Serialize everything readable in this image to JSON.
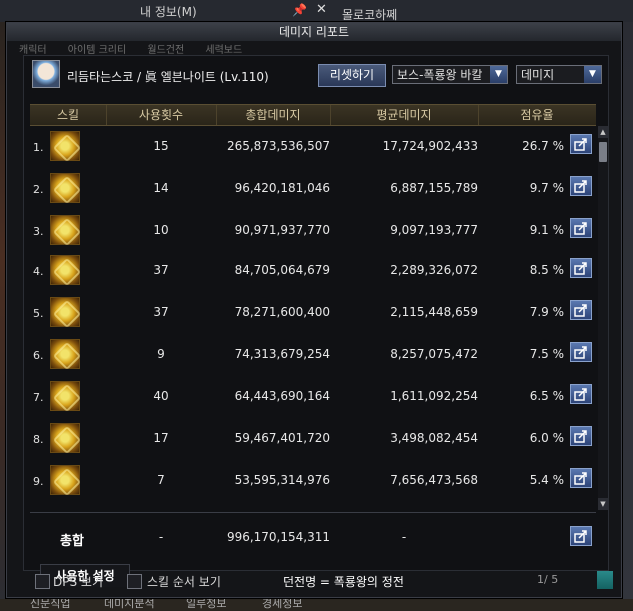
{
  "background": {
    "top_title": "내 정보(M)",
    "top_right": "몰로코하쩨",
    "bottom_items": [
      "신문직업",
      "데미지분석",
      "일루정보",
      "경세정보"
    ]
  },
  "window": {
    "title": "데미지 리포트",
    "faded_tabs": [
      "캐릭터",
      "아이템 크리티",
      "월드건전",
      "세력보드"
    ]
  },
  "header": {
    "character": "리듬타는스코 / 眞 엘븐나이트 (Lv.110)",
    "reset_button": "리셋하기",
    "boss_select": "보스-폭룡왕 바칼",
    "type_select": "데미지"
  },
  "columns": [
    "스킬",
    "사용횟수",
    "총합데미지",
    "평균데미지",
    "점유율"
  ],
  "rows": [
    {
      "rank": "1.",
      "uses": "15",
      "total": "265,873,536,507",
      "avg": "17,724,902,433",
      "share": "26.7 %"
    },
    {
      "rank": "2.",
      "uses": "14",
      "total": "96,420,181,046",
      "avg": "6,887,155,789",
      "share": "9.7 %"
    },
    {
      "rank": "3.",
      "uses": "10",
      "total": "90,971,937,770",
      "avg": "9,097,193,777",
      "share": "9.1 %"
    },
    {
      "rank": "4.",
      "uses": "37",
      "total": "84,705,064,679",
      "avg": "2,289,326,072",
      "share": "8.5 %"
    },
    {
      "rank": "5.",
      "uses": "37",
      "total": "78,271,600,400",
      "avg": "2,115,448,659",
      "share": "7.9 %"
    },
    {
      "rank": "6.",
      "uses": "9",
      "total": "74,313,679,254",
      "avg": "8,257,075,472",
      "share": "7.5 %"
    },
    {
      "rank": "7.",
      "uses": "40",
      "total": "64,443,690,164",
      "avg": "1,611,092,254",
      "share": "6.5 %"
    },
    {
      "rank": "8.",
      "uses": "17",
      "total": "59,467,401,720",
      "avg": "3,498,082,454",
      "share": "6.0 %"
    },
    {
      "rank": "9.",
      "uses": "7",
      "total": "53,595,314,976",
      "avg": "7,656,473,568",
      "share": "5.4 %"
    }
  ],
  "total_row": {
    "label": "총합",
    "uses": "-",
    "total": "996,170,154,311",
    "avg": "-"
  },
  "settings_tab": "사용한 설정",
  "footer": {
    "dps_label": "DPS 보기",
    "skill_order_label": "스킬 순서 보기",
    "dungeon": "던전명 = 폭룡왕의 정전",
    "page": "1/ 5"
  }
}
